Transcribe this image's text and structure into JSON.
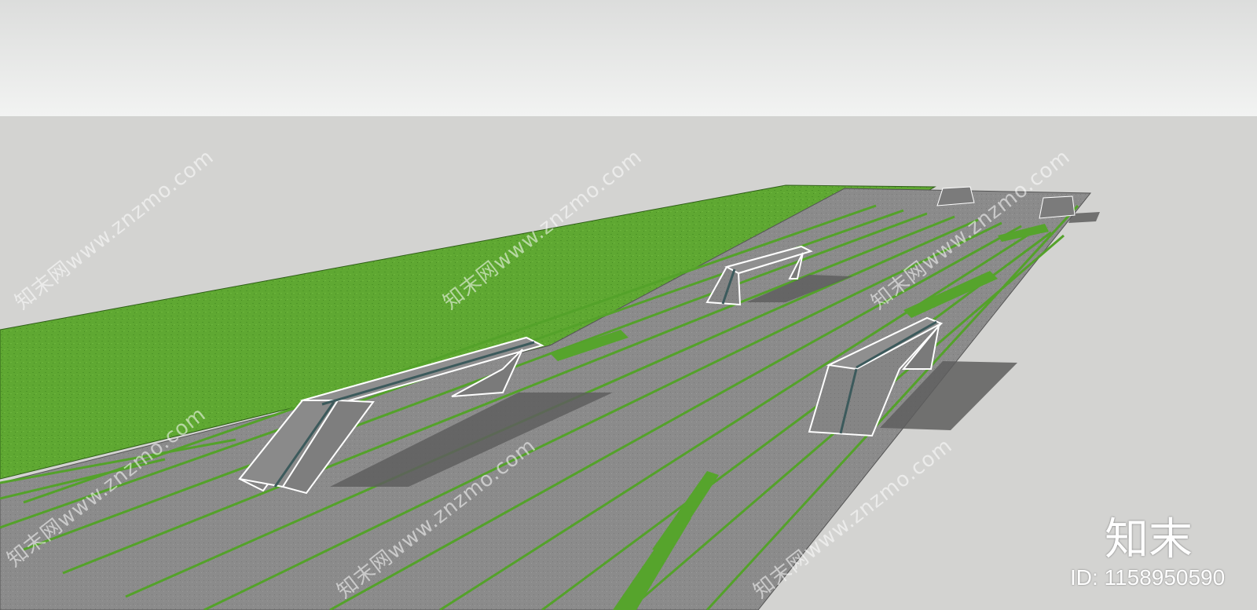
{
  "colors": {
    "sky": "#e8e9e8",
    "ground": "#d3d3d1",
    "lawn": "#5aa52e",
    "paving": "#8a8a8a",
    "bench": "#7d7d7d"
  },
  "watermarks": [
    "知末网www.znzmo.com",
    "知末网www.znzmo.com",
    "知末网www.znzmo.com",
    "知末网www.znzmo.com",
    "知末网www.znzmo.com",
    "知末网www.znzmo.com"
  ],
  "logo": {
    "brand": "知末",
    "id_label": "ID: 1158950590"
  }
}
